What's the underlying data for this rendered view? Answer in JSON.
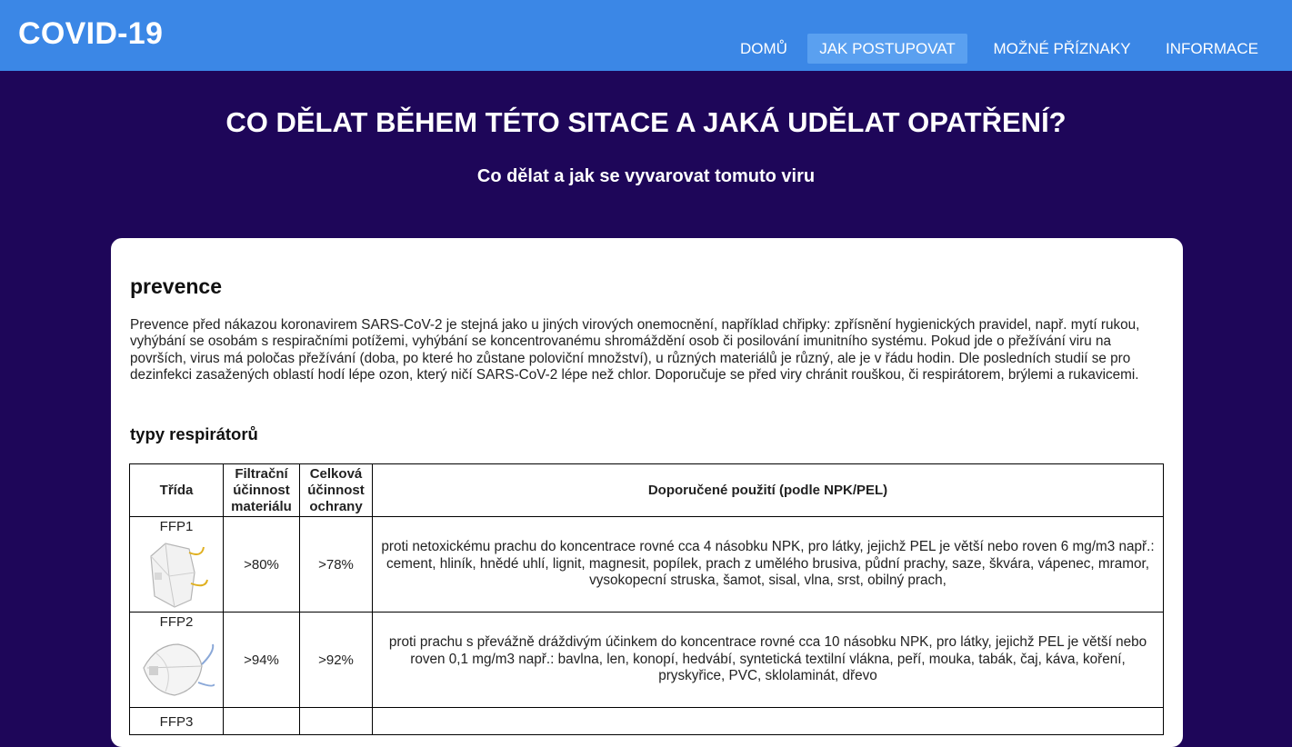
{
  "header": {
    "logo": "COVID-19",
    "nav": [
      {
        "label": "DOMŮ",
        "active": false
      },
      {
        "label": "JAK POSTUPOVAT",
        "active": true
      },
      {
        "label": "MOŽNÉ PŘÍZNAKY",
        "active": false
      },
      {
        "label": "INFORMACE",
        "active": false
      }
    ]
  },
  "hero": {
    "title": "CO DĚLAT BĚHEM TÉTO SITACE A JAKÁ UDĚLAT OPATŘENÍ?",
    "subtitle": "Co dělat a jak se vyvarovat tomuto viru"
  },
  "content": {
    "section_title": "prevence",
    "paragraph": "Prevence před nákazou koronavirem SARS-CoV-2 je stejná jako u jiných virových onemocnění, například chřipky: zpřísnění hygienických pravidel, např. mytí rukou, vyhýbání se osobám s respiračními potížemi, vyhýbání se koncentrovanému shromáždění osob či posilování imunitního systému. Pokud jde o přežívání viru na površích, virus má poločas přežívání (doba, po které ho zůstane poloviční množství), u různých materiálů je různý, ale je v řádu hodin. Dle posledních studií se pro dezinfekci zasažených oblastí hodí lépe ozon, který ničí SARS-CoV-2 lépe než chlor. Doporučuje se před viry chránit rouškou, či respirátorem, brýlemi a rukavicemi.",
    "subsection_title": "typy respirátorů",
    "table": {
      "headers": [
        "Třída",
        "Filtrační účinnost materiálu",
        "Celková účinnost ochrany",
        "Doporučené použití (podle NPK/PEL)"
      ],
      "rows": [
        {
          "class": "FFP1",
          "image": "respirator-mask-icon",
          "filter": ">80%",
          "total": ">78%",
          "use": "proti netoxickému prachu do koncentrace rovné cca 4 násobku NPK, pro látky, jejichž PEL je větší nebo roven 6 mg/m3 např.: cement, hliník, hnědé uhlí, lignit, magnesit, popílek, prach z umělého brusiva, půdní prachy, saze, škvára, vápenec, mramor, vysokopecní struska, šamot, sisal, vlna, srst, obilný prach,"
        },
        {
          "class": "FFP2",
          "image": "respirator-mask-icon",
          "filter": ">94%",
          "total": ">92%",
          "use": "proti prachu s převážně dráždivým účinkem do koncentrace rovné cca 10 násobku NPK, pro látky, jejichž PEL je větší nebo roven 0,1 mg/m3 např.: bavlna, len, konopí, hedvábí, syntetická textilní vlákna, peří, mouka, tabák, čaj, káva, koření, pryskyřice, PVC, sklolaminát, dřevo"
        },
        {
          "class": "FFP3",
          "image": "",
          "filter": "",
          "total": "",
          "use": ""
        }
      ]
    }
  },
  "colors": {
    "header_bg": "#3b87e6",
    "nav_active_bg": "#5aa0f0",
    "page_bg": "#1e0659",
    "card_bg": "#ffffff"
  }
}
